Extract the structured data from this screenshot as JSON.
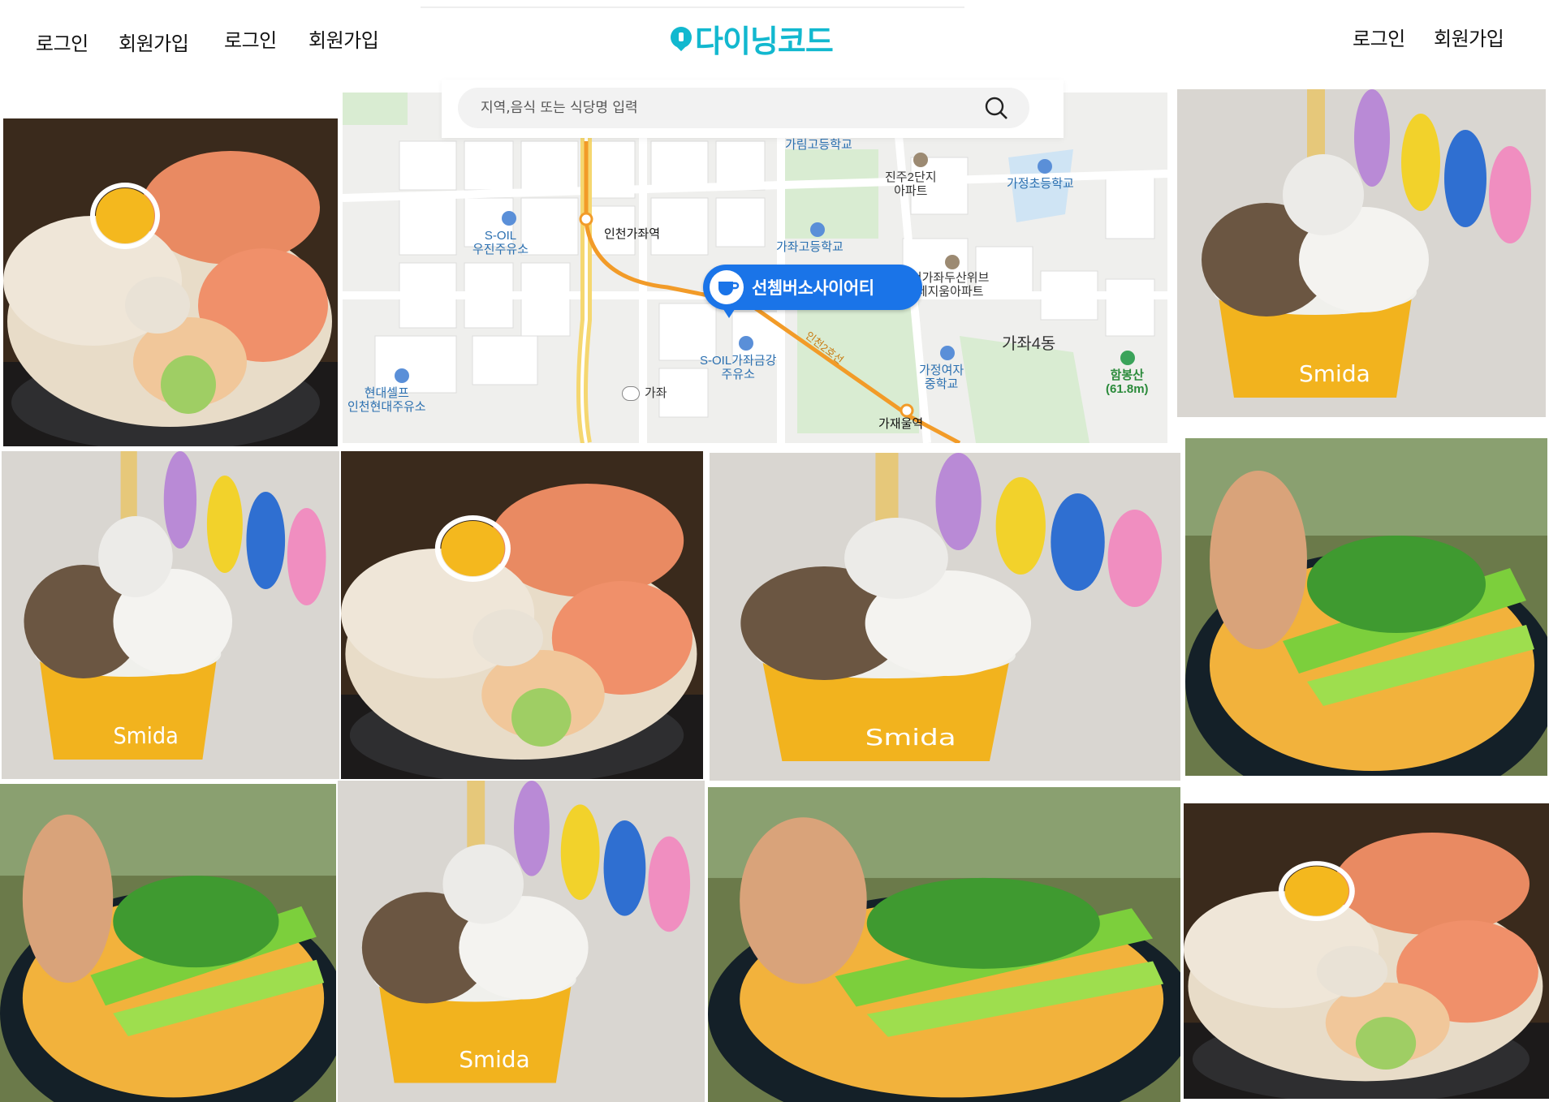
{
  "header": {
    "left_links": [
      "로그인",
      "회원가입",
      "로그인",
      "회원가입"
    ],
    "right_links": [
      "로그인",
      "회원가입"
    ],
    "logo_text": "다이닝코드",
    "brand_color": "#12b8cf"
  },
  "search": {
    "placeholder": "지역,음식 또는 식당명 입력",
    "icon": "search-icon"
  },
  "map": {
    "labels": {
      "school_garim": "가림고등학교",
      "apt_jinju": "진주2단지\n아파트",
      "school_gajeong_elem": "가정초등학교",
      "soil_ujin": "S-OIL\n우진주유소",
      "station_gajwa": "인천가좌역",
      "school_gajwa_high": "가좌고등학교",
      "apt_doosan": "인천가좌두산위브\n트레지움아파트",
      "dong_gajwa4": "가좌4동",
      "soil_geumgang": "S-OIL가좌금강\n주유소",
      "school_gajeong_girls": "가정여자\n중학교",
      "mountain": "함봉산\n(61.8m)",
      "hyundai": "현대셀프\n인천현대주유소",
      "ic_gajwa": "가좌",
      "station_gajae": "가재울역",
      "road": "인천2호선"
    },
    "pin_label": "선쳄버소사이어티",
    "pin_color": "#1a74e8"
  },
  "photos": [
    {
      "dish": "salmon-scallop-bowl"
    },
    {
      "dish": "ice-cream-cup"
    },
    {
      "dish": "ice-cream-cup"
    },
    {
      "dish": "salmon-scallop-bowl"
    },
    {
      "dish": "ice-cream-cup"
    },
    {
      "dish": "curry-noodle-bowl"
    },
    {
      "dish": "curry-noodle-bowl"
    },
    {
      "dish": "ice-cream-cup"
    },
    {
      "dish": "curry-noodle-bowl"
    },
    {
      "dish": "salmon-scallop-bowl"
    }
  ],
  "cup_brand_text": "Smida"
}
